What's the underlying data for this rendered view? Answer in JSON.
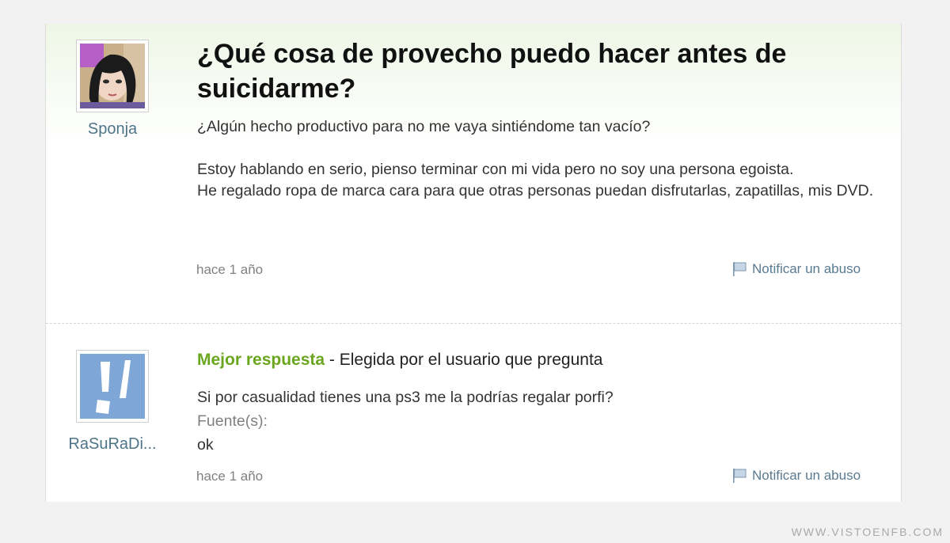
{
  "question": {
    "username": "Sponja",
    "title": "¿Qué cosa de provecho puedo hacer antes de suicidarme?",
    "lead": "¿Algún hecho productivo para no me vaya sintiéndome tan vacío?",
    "paragraph": "Estoy hablando en serio, pienso terminar con mi vida pero no soy una persona egoista.",
    "paragraph2": "He regalado ropa de marca cara para que otras personas puedan disfrutarlas, zapatillas, mis DVD.",
    "time": "hace 1 año",
    "report_label": "Notificar un abuso"
  },
  "answer": {
    "username": "RaSuRaDi...",
    "best_label": "Mejor respuesta",
    "chosen_text": " - Elegida por el usuario que pregunta",
    "body": "Si por casualidad tienes una ps3 me la podrías regalar porfi?",
    "source_label": "Fuente(s):",
    "source_value": "ok",
    "time": "hace 1 año",
    "report_label": "Notificar un abuso"
  },
  "watermark": "WWW.VISTOENFB.COM",
  "colors": {
    "accent_green": "#6aa61e",
    "username_blue": "#4e7488",
    "link_blue": "#5a7a92",
    "default_avatar": "#7ea6d6"
  },
  "icons": {
    "report": "flag-icon"
  }
}
